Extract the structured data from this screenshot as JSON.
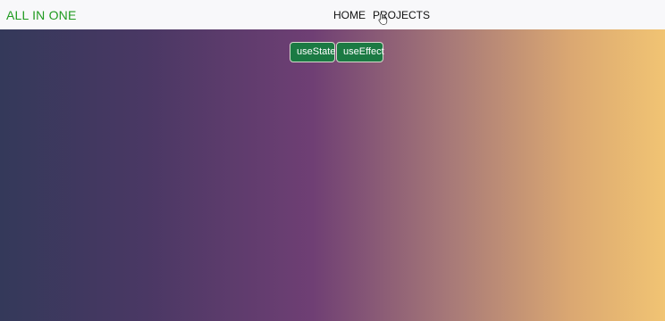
{
  "navbar": {
    "brand": "ALL IN ONE",
    "links": [
      "HOME",
      "PROJECTS"
    ]
  },
  "main": {
    "buttons": [
      "useState",
      "useEffect"
    ]
  },
  "colors": {
    "brand_green": "#1f9a1f",
    "button_green": "#1b7a43",
    "gradient_left": "#34395a",
    "gradient_mid": "#6f3f74",
    "gradient_right": "#f1c473"
  },
  "icons": {
    "cursor": "hand-pointer-icon"
  }
}
